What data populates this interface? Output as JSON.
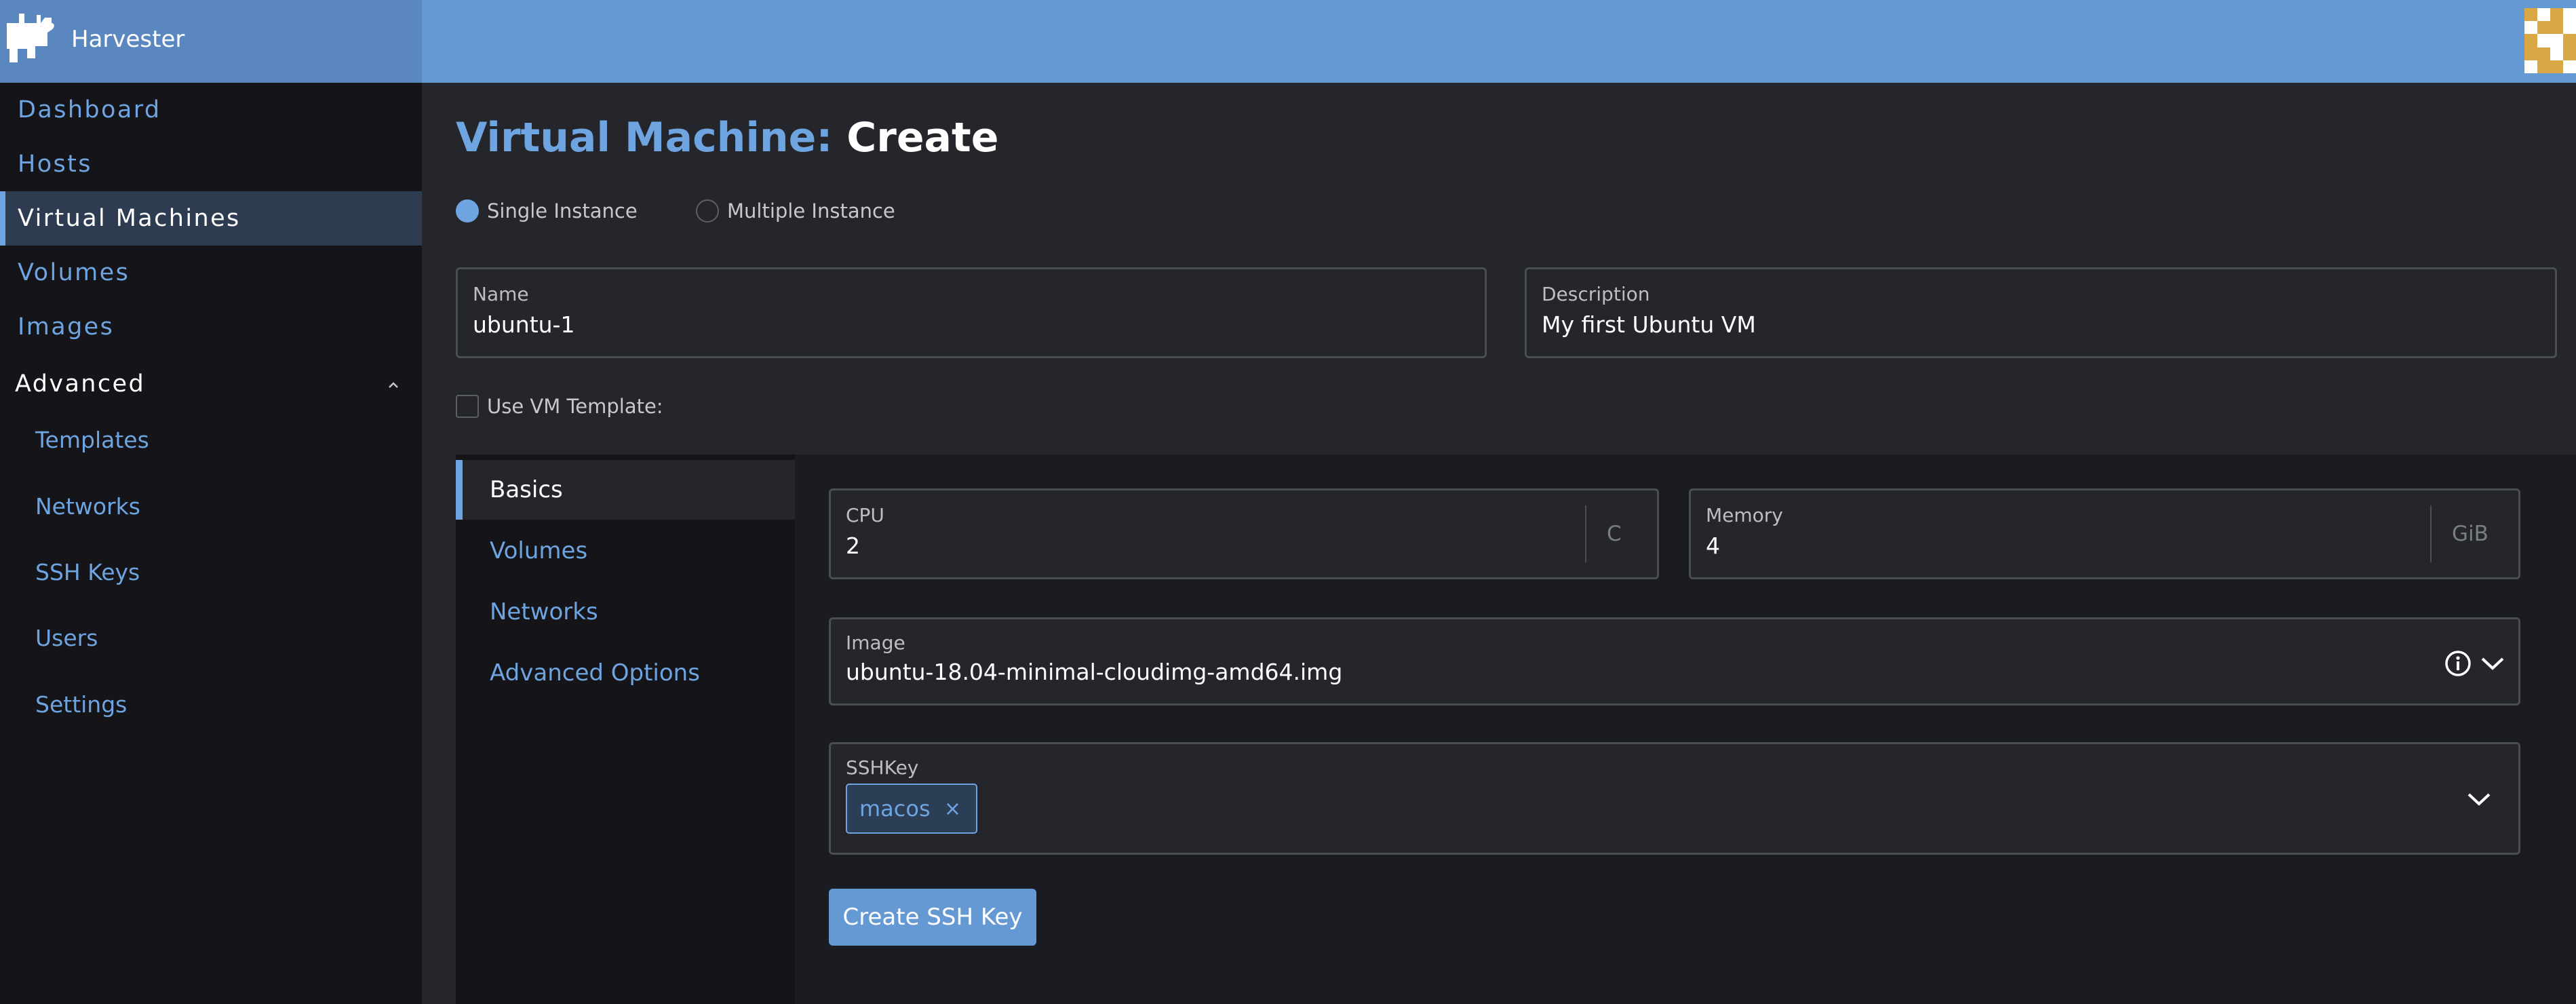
{
  "app": {
    "name": "Harvester"
  },
  "sidebar": {
    "items": [
      {
        "label": "Dashboard"
      },
      {
        "label": "Hosts"
      },
      {
        "label": "Virtual Machines"
      },
      {
        "label": "Volumes"
      },
      {
        "label": "Images"
      }
    ],
    "group": {
      "label": "Advanced",
      "items": [
        {
          "label": "Templates"
        },
        {
          "label": "Networks"
        },
        {
          "label": "SSH Keys"
        },
        {
          "label": "Users"
        },
        {
          "label": "Settings"
        }
      ]
    }
  },
  "page": {
    "title_prefix": "Virtual Machine:",
    "title_action": "Create"
  },
  "instance": {
    "single_label": "Single Instance",
    "multiple_label": "Multiple Instance",
    "selected": "single"
  },
  "form": {
    "name": {
      "label": "Name",
      "value": "ubuntu-1"
    },
    "description": {
      "label": "Description",
      "value": "My first Ubuntu VM"
    },
    "use_template": {
      "label": "Use VM Template:",
      "checked": false
    }
  },
  "tabs": [
    {
      "label": "Basics"
    },
    {
      "label": "Volumes"
    },
    {
      "label": "Networks"
    },
    {
      "label": "Advanced Options"
    }
  ],
  "basics": {
    "cpu": {
      "label": "CPU",
      "value": "2",
      "unit": "C"
    },
    "memory": {
      "label": "Memory",
      "value": "4",
      "unit": "GiB"
    },
    "image": {
      "label": "Image",
      "value": "ubuntu-18.04-minimal-cloudimg-amd64.img"
    },
    "sshkey": {
      "label": "SSHKey",
      "tags": [
        "macos"
      ],
      "remove_glyph": "×"
    },
    "create_ssh_key_label": "Create SSH Key"
  },
  "colors": {
    "accent": "#6ea4e0",
    "header": "#6599d3",
    "sidebar": "#141419",
    "main": "#25262c"
  }
}
